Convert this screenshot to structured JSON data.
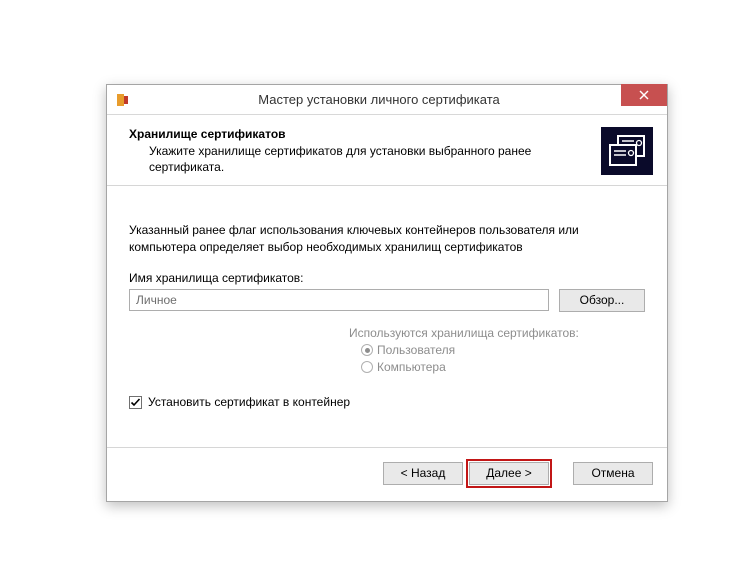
{
  "window": {
    "title": "Мастер установки личного сертификата"
  },
  "header": {
    "title": "Хранилище сертификатов",
    "description": "Укажите хранилище сертификатов для установки выбранного ранее сертификата."
  },
  "body": {
    "info_text": "Указанный ранее флаг использования ключевых контейнеров пользователя или компьютера определяет выбор необходимых хранилищ сертификатов",
    "storage_name_label": "Имя хранилища сертификатов:",
    "storage_name_value": "Личное",
    "browse_label": "Обзор...",
    "storage_used_label": "Используются хранилища сертификатов:",
    "radio_user": "Пользователя",
    "radio_computer": "Компьютера",
    "checkbox_install": "Установить сертификат в контейнер"
  },
  "footer": {
    "back": "< Назад",
    "next": "Далее >",
    "cancel": "Отмена"
  }
}
